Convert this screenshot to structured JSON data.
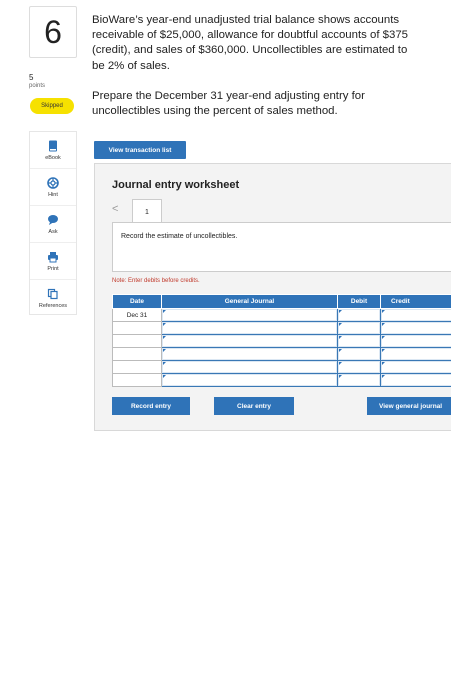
{
  "question": {
    "number": "6",
    "points_value": "5",
    "points_label": "points",
    "status": "Skipped",
    "text_1": "BioWare’s year-end unadjusted trial balance shows accounts receivable of $25,000, allowance for doubtful accounts of $375 (credit), and sales of $360,000. Uncollectibles are estimated to be 2% of sales.",
    "text_2": "Prepare the December 31 year-end adjusting entry for uncollectibles using the percent of sales method."
  },
  "tools": [
    {
      "label": "eBook",
      "icon": "book-icon"
    },
    {
      "label": "Hint",
      "icon": "lifebuoy-icon"
    },
    {
      "label": "Ask",
      "icon": "chat-icon"
    },
    {
      "label": "Print",
      "icon": "printer-icon"
    },
    {
      "label": "References",
      "icon": "copy-icon"
    }
  ],
  "view_transactions_label": "View transaction list",
  "worksheet": {
    "title": "Journal entry worksheet",
    "prev_symbol": "<",
    "tab": "1",
    "instruction": "Record the estimate of uncollectibles.",
    "note": "Note: Enter debits before credits.",
    "columns": [
      "Date",
      "General Journal",
      "Debit",
      "Credit"
    ],
    "rows": [
      {
        "date": "Dec 31"
      },
      {
        "date": ""
      },
      {
        "date": ""
      },
      {
        "date": ""
      },
      {
        "date": ""
      },
      {
        "date": ""
      }
    ],
    "record_label": "Record entry",
    "clear_label": "Clear entry",
    "general_label": "View general journal"
  },
  "colors": {
    "accent": "#2f73b8",
    "skipped": "#f6e100",
    "note": "#c0392b"
  }
}
